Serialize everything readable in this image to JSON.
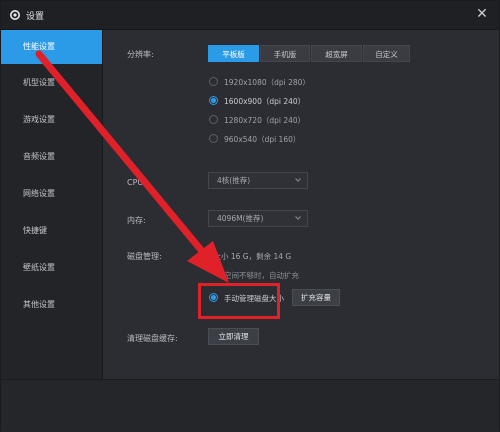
{
  "window": {
    "title": "设置"
  },
  "sidebar": {
    "items": [
      {
        "label": "性能设置",
        "active": true
      },
      {
        "label": "机型设置"
      },
      {
        "label": "游戏设置"
      },
      {
        "label": "音频设置"
      },
      {
        "label": "网络设置"
      },
      {
        "label": "快捷键"
      },
      {
        "label": "壁纸设置"
      },
      {
        "label": "其他设置"
      }
    ]
  },
  "resolution": {
    "label": "分辨率:",
    "modes": [
      "平板版",
      "手机版",
      "超宽屏",
      "自定义"
    ],
    "options": [
      "1920x1080（dpi 280）",
      "1600x900（dpi 240）",
      "1280x720（dpi 240）",
      "960x540（dpi 160）"
    ],
    "selected_index": 1
  },
  "cpu": {
    "label": "CPU：",
    "value": "4核(推荐)"
  },
  "memory": {
    "label": "内存:",
    "value": "4096M(推荐)"
  },
  "disk": {
    "label": "磁盘管理:",
    "info": "总大小 16 G，剩余 14 G",
    "auto_text": "空间不够时，自动扩充",
    "manual_text": "手动管理磁盘大小",
    "expand_button": "扩充容量"
  },
  "cache": {
    "label": "清理磁盘缓存:",
    "button": "立即清理"
  },
  "colors": {
    "accent": "#2b9be8",
    "annotation": "#e0212a"
  }
}
